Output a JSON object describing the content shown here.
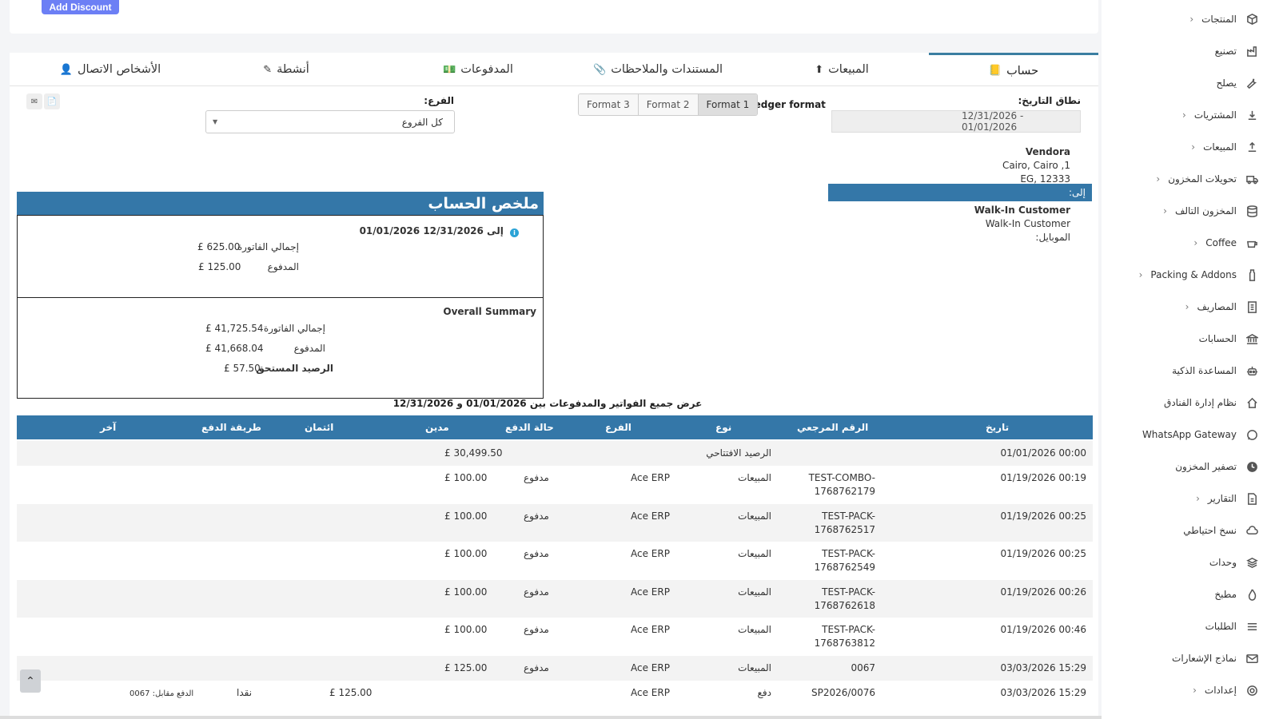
{
  "top": {
    "add_discount": "Add Discount"
  },
  "tabs": [
    {
      "label": "حساب",
      "icon": "ledger-icon"
    },
    {
      "label": "المبيعات",
      "icon": "arrow-up-circle-icon"
    },
    {
      "label": "المستندات والملاحظات",
      "icon": "paperclip-icon"
    },
    {
      "label": "المدفوعات",
      "icon": "money-icon"
    },
    {
      "label": "أنشطة",
      "icon": "edit-icon"
    },
    {
      "label": "الأشخاص الاتصال",
      "icon": "user-plus-icon"
    }
  ],
  "filters": {
    "date_range_label": "نطاق التاريخ:",
    "date_range_value": "12/31/2026 - 01/01/2026",
    "ledger_format_label": "Ledger format",
    "formats": [
      "Format 1",
      "Format 2",
      "Format 3"
    ],
    "active_format": "Format 1",
    "branch_label": "الفرع:",
    "branch_value": "كل الفروع"
  },
  "vendor": {
    "name": "Vendora",
    "address1": "Cairo, Cairo ,1",
    "address2": "EG, 12333"
  },
  "to": {
    "label": "إلى:",
    "customer_bold": "Walk-In Customer",
    "customer_name": "Walk-In Customer",
    "mobile_label": "الموبايل:"
  },
  "summary": {
    "title": "ملخص الحساب",
    "period": "01/01/2026 إلى 12/31/2026",
    "period_total_label": "إجمالي الفاتورة",
    "period_total_value": "£ 625.00",
    "period_paid_label": "المدفوع",
    "period_paid_value": "£ 125.00",
    "overall_title": "Overall Summary",
    "overall_total_label": "إجمالي الفاتورة",
    "overall_total_value": "£ 41,725.54",
    "overall_paid_label": "المدفوع",
    "overall_paid_value": "£ 41,668.04",
    "balance_label": "الرصيد المستحق",
    "balance_value": "£ 57.50"
  },
  "table": {
    "caption": "عرض جميع الفواتير والمدفوعات بين 01/01/2026 و 12/31/2026",
    "headers": {
      "date": "تاريخ",
      "ref": "الرقم المرجعي",
      "type": "نوع",
      "branch": "الفرع",
      "status": "حالة الدفع",
      "debit": "مدين",
      "credit": "ائتمان",
      "method": "طريقة الدفع",
      "other": "آخر"
    },
    "rows": [
      {
        "date": "01/01/2026 00:00",
        "ref1": "",
        "ref2": "",
        "type": "الرصيد الافتتاحي",
        "branch": "",
        "status": "",
        "debit": "£ 30,499.50",
        "credit": "",
        "method": "",
        "other": ""
      },
      {
        "date": "01/19/2026 00:19",
        "ref1": "TEST-COMBO-",
        "ref2": "1768762179",
        "type": "المبيعات",
        "branch": "Ace ERP",
        "status": "مدفوع",
        "debit": "£ 100.00",
        "credit": "",
        "method": "",
        "other": ""
      },
      {
        "date": "01/19/2026 00:25",
        "ref1": "TEST-PACK-",
        "ref2": "1768762517",
        "type": "المبيعات",
        "branch": "Ace ERP",
        "status": "مدفوع",
        "debit": "£ 100.00",
        "credit": "",
        "method": "",
        "other": ""
      },
      {
        "date": "01/19/2026 00:25",
        "ref1": "TEST-PACK-",
        "ref2": "1768762549",
        "type": "المبيعات",
        "branch": "Ace ERP",
        "status": "مدفوع",
        "debit": "£ 100.00",
        "credit": "",
        "method": "",
        "other": ""
      },
      {
        "date": "01/19/2026 00:26",
        "ref1": "TEST-PACK-",
        "ref2": "1768762618",
        "type": "المبيعات",
        "branch": "Ace ERP",
        "status": "مدفوع",
        "debit": "£ 100.00",
        "credit": "",
        "method": "",
        "other": ""
      },
      {
        "date": "01/19/2026 00:46",
        "ref1": "TEST-PACK-",
        "ref2": "1768763812",
        "type": "المبيعات",
        "branch": "Ace ERP",
        "status": "مدفوع",
        "debit": "£ 100.00",
        "credit": "",
        "method": "",
        "other": ""
      },
      {
        "date": "03/03/2026 15:29",
        "ref1": "0067",
        "ref2": "",
        "type": "المبيعات",
        "branch": "Ace ERP",
        "status": "مدفوع",
        "debit": "£ 125.00",
        "credit": "",
        "method": "",
        "other": ""
      },
      {
        "date": "03/03/2026 15:29",
        "ref1": "SP2026/0076",
        "ref2": "",
        "type": "دفع",
        "branch": "Ace ERP",
        "status": "",
        "debit": "",
        "credit": "£ 125.00",
        "method": "نقدا",
        "other": "الدفع مقابل: 0067"
      }
    ]
  },
  "sidebar": {
    "items": [
      {
        "label": "المنتجات",
        "icon": "cube-icon",
        "chevron": true
      },
      {
        "label": "تصنيع",
        "icon": "factory-icon",
        "chevron": false
      },
      {
        "label": "يصلح",
        "icon": "wrench-icon",
        "chevron": false
      },
      {
        "label": "المشتريات",
        "icon": "download-icon",
        "chevron": true
      },
      {
        "label": "المبيعات",
        "icon": "upload-icon",
        "chevron": true
      },
      {
        "label": "تحويلات المخزون",
        "icon": "truck-icon",
        "chevron": true
      },
      {
        "label": "المخزون التالف",
        "icon": "database-icon",
        "chevron": true
      },
      {
        "label": "Coffee",
        "icon": "coffee-icon",
        "chevron": true
      },
      {
        "label": "Packing & Addons",
        "icon": "bottle-icon",
        "chevron": true
      },
      {
        "label": "المصاريف",
        "icon": "receipt-icon",
        "chevron": true
      },
      {
        "label": "الحسابات",
        "icon": "bank-icon",
        "chevron": false
      },
      {
        "label": "المساعدة الذكية",
        "icon": "robot-icon",
        "chevron": false
      },
      {
        "label": "نظام إدارة الفنادق",
        "icon": "home-icon",
        "chevron": false
      },
      {
        "label": "WhatsApp Gateway",
        "icon": "whatsapp-icon",
        "chevron": false
      },
      {
        "label": "تصفير المخزون",
        "icon": "clock-icon",
        "chevron": false
      },
      {
        "label": "التقارير",
        "icon": "report-icon",
        "chevron": true
      },
      {
        "label": "نسخ احتياطي",
        "icon": "cloud-icon",
        "chevron": false
      },
      {
        "label": "وحدات",
        "icon": "layers-icon",
        "chevron": false
      },
      {
        "label": "مطبخ",
        "icon": "flame-icon",
        "chevron": false
      },
      {
        "label": "الطلبات",
        "icon": "list-icon",
        "chevron": false
      },
      {
        "label": "نماذج الإشعارات",
        "icon": "mail-icon",
        "chevron": false
      },
      {
        "label": "إعدادات",
        "icon": "settings-icon",
        "chevron": true
      }
    ]
  }
}
